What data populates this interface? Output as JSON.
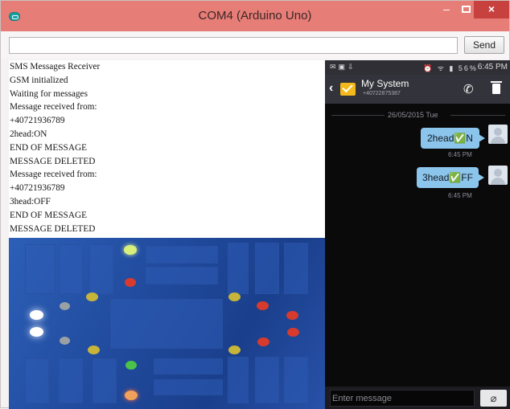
{
  "window": {
    "title": "COM4 (Arduino Uno)",
    "controls": {
      "minimize": "–",
      "close": "×"
    }
  },
  "serial": {
    "input_value": "",
    "send_label": "Send",
    "lines": [
      "SMS Messages Receiver",
      "GSM initialized",
      "Waiting for messages",
      "Message received from:",
      "+40721936789",
      "2head:ON",
      "END OF MESSAGE",
      "MESSAGE DELETED",
      "Message received from:",
      "+40721936789",
      "3head:OFF",
      "END OF MESSAGE",
      "MESSAGE DELETED"
    ]
  },
  "phone": {
    "status": {
      "time": "6:45 PM",
      "battery": "56%"
    },
    "contact": {
      "name": "My System",
      "number": "+40722875387"
    },
    "date_separator": "26/05/2015 Tue",
    "messages": [
      {
        "text": "2head✅N",
        "time": "6:45 PM"
      },
      {
        "text": "3head✅FF",
        "time": "6:45 PM"
      }
    ],
    "compose_placeholder": "Enter message"
  },
  "icons": {
    "app": "arduino-icon",
    "back": "back-arrow-icon",
    "envelope": "message-envelope-icon",
    "call": "phone-call-icon",
    "delete": "trash-icon",
    "attach": "paperclip-icon"
  },
  "colors": {
    "titlebar": "#e77d77",
    "close_button": "#c7413f",
    "bubble": "#8cc5ec",
    "phone_header": "#33333b",
    "board": "#2c5fb7"
  }
}
